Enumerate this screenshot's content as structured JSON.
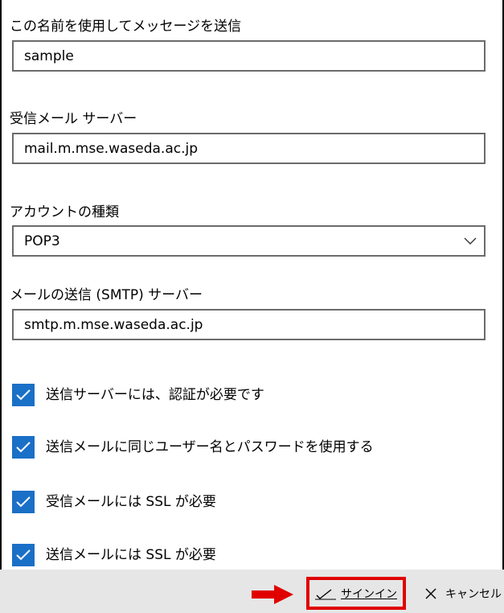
{
  "form": {
    "display_name": {
      "label": "この名前を使用してメッセージを送信",
      "value": "sample"
    },
    "incoming_server": {
      "label": "受信メール サーバー",
      "value": "mail.m.mse.waseda.ac.jp"
    },
    "account_type": {
      "label": "アカウントの種類",
      "value": "POP3"
    },
    "outgoing_server": {
      "label": "メールの送信 (SMTP) サーバー",
      "value": "smtp.m.mse.waseda.ac.jp"
    },
    "checkboxes": [
      {
        "label": "送信サーバーには、認証が必要です",
        "checked": true
      },
      {
        "label": "送信メールに同じユーザー名とパスワードを使用する",
        "checked": true
      },
      {
        "label": "受信メールには SSL が必要",
        "checked": true
      },
      {
        "label": "送信メールには SSL が必要",
        "checked": true
      }
    ]
  },
  "footer": {
    "signin_label": "サインイン",
    "cancel_label": "キャンセル"
  },
  "colors": {
    "checkbox": "#1a6fc7",
    "highlight": "#e00000",
    "footer_bg": "#e6e6e6"
  },
  "icons": {
    "signin": "checkmark-icon",
    "cancel": "close-icon",
    "dropdown": "chevron-down-icon",
    "annotation": "red-arrow-icon"
  }
}
